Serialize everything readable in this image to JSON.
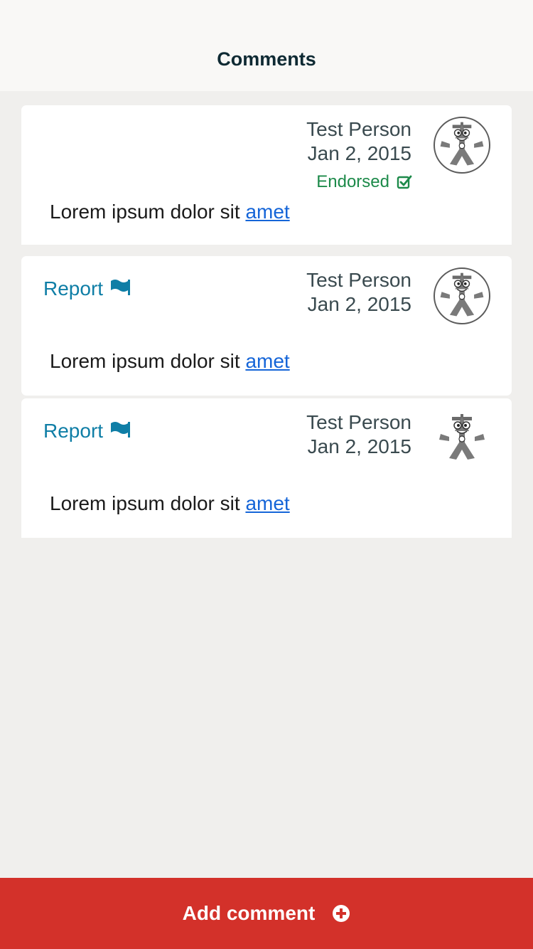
{
  "header": {
    "title": "Comments"
  },
  "comments": [
    {
      "author": "Test Person",
      "date": "Jan 2, 2015",
      "endorsed_label": "Endorsed",
      "body_text": "Lorem ipsum dolor sit ",
      "body_link": "amet"
    },
    {
      "author": "Test Person",
      "date": "Jan 2, 2015",
      "report_label": "Report",
      "body_text": "Lorem ipsum dolor sit ",
      "body_link": "amet"
    },
    {
      "author": "Test Person",
      "date": "Jan 2, 2015",
      "report_label": "Report",
      "body_text": "Lorem ipsum dolor sit ",
      "body_link": "amet"
    }
  ],
  "footer": {
    "add_comment_label": "Add comment"
  },
  "colors": {
    "accent_red": "#d3312a",
    "link_blue": "#1565d8",
    "report_teal": "#0f7ea6",
    "endorsed_green": "#1d8a4a"
  },
  "icons": {
    "endorsed": "check-square-icon",
    "report": "flag-icon",
    "add": "plus-circle-icon",
    "avatar": "mascot-avatar"
  }
}
